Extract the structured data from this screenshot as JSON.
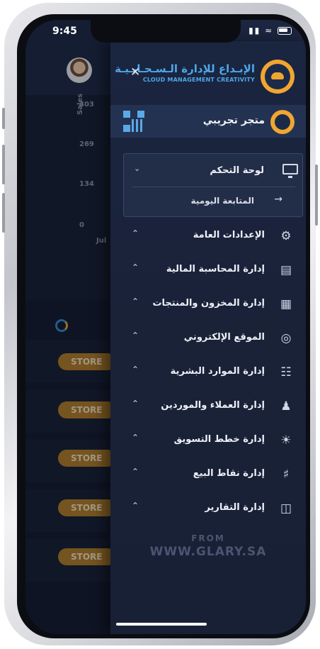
{
  "status_bar": {
    "time": "9:45"
  },
  "background": {
    "chart": {
      "ylabel": "Sales",
      "ticks": [
        "403",
        "269",
        "134",
        "0"
      ],
      "xtick": "Jul"
    },
    "store_pills": [
      "STORE",
      "STORE",
      "STORE",
      "STORE",
      "STORE"
    ]
  },
  "drawer": {
    "brand_ar": "الإبـداع للإدارة الـسـحـابـيـة",
    "brand_en": "CLOUD MANAGEMENT CREATIVITY",
    "close_label": "✕",
    "store_name": "متجر تجريبي",
    "dashboard": {
      "title": "لوحة التحكم",
      "sub_item": "المتابعة اليومية"
    },
    "items": [
      {
        "label": "الإعدادات العامة",
        "icon": "gears-icon"
      },
      {
        "label": "إدارة المحاسبة المالية",
        "icon": "ledger-icon"
      },
      {
        "label": "إدارة المخزون والمنتجات",
        "icon": "inventory-icon"
      },
      {
        "label": "الموقع الإلكتروني",
        "icon": "globe-icon"
      },
      {
        "label": "إدارة الموارد البشرية",
        "icon": "org-chart-icon"
      },
      {
        "label": "إدارة العملاء والموردين",
        "icon": "users-icon"
      },
      {
        "label": "إدارة خطط التسويق",
        "icon": "lightbulb-icon"
      },
      {
        "label": "إدارة نقاط البيع",
        "icon": "cart-icon"
      },
      {
        "label": "إدارة التقارير",
        "icon": "briefcase-icon"
      }
    ],
    "footer_from": "FROM",
    "footer_site": "WWW.GLARY.SA"
  }
}
